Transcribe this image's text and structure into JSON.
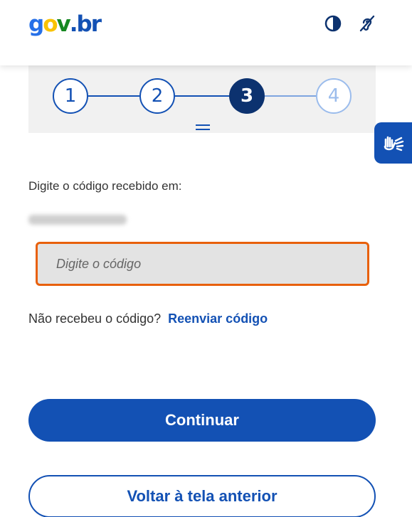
{
  "header": {
    "logo": {
      "parts": [
        "g",
        "o",
        "v",
        ".",
        "b",
        "r"
      ],
      "colors": [
        "#2670e8",
        "#f9c200",
        "#168821",
        "#1351b4",
        "#1351b4",
        "#1351b4"
      ]
    },
    "icons": [
      "contrast-icon",
      "accessibility-hearing-icon"
    ]
  },
  "stepper": {
    "steps": [
      {
        "label": "1",
        "state": "done"
      },
      {
        "label": "2",
        "state": "done"
      },
      {
        "label": "3",
        "state": "current"
      },
      {
        "label": "4",
        "state": "pending"
      }
    ]
  },
  "vlibras": {
    "icon": "sign-language-hands-icon"
  },
  "form": {
    "instruction": "Digite o código recebido em:",
    "code_placeholder": "Digite o código",
    "resend_question": "Não recebeu o código?",
    "resend_link": "Reenviar código"
  },
  "buttons": {
    "continue_label": "Continuar",
    "back_label": "Voltar à tela anterior"
  },
  "colors": {
    "primary": "#1351b4",
    "step_current": "#0c326f",
    "focus_border": "#e8600b"
  }
}
